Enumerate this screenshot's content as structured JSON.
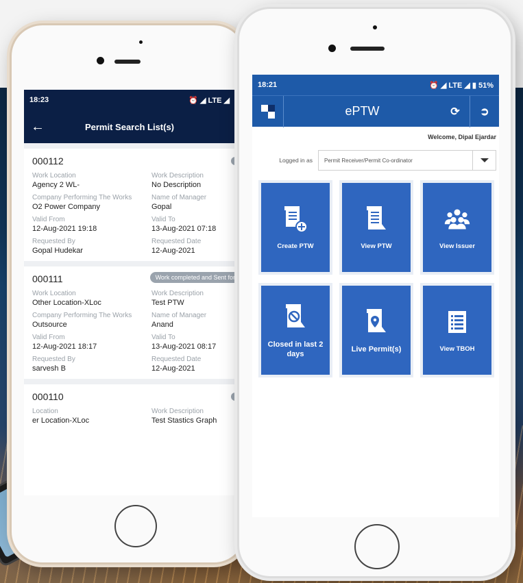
{
  "list_screen": {
    "status_time": "18:23",
    "status_icons": "⏰ ◢ LTE ◢",
    "title": "Permit Search List(s)",
    "permits": [
      {
        "id": "000112",
        "badge": "",
        "fields": [
          {
            "label": "Work Location",
            "value": "Agency 2 WL-"
          },
          {
            "label": "Work Description",
            "value": "No Description"
          },
          {
            "label": "Company Performing The Works",
            "value": "O2 Power Company"
          },
          {
            "label": "Name of Manager",
            "value": "Gopal"
          },
          {
            "label": "Valid From",
            "value": "12-Aug-2021 19:18"
          },
          {
            "label": "Valid To",
            "value": "13-Aug-2021 07:18"
          },
          {
            "label": "Requested By",
            "value": "Gopal Hudekar"
          },
          {
            "label": "Requested Date",
            "value": "12-Aug-2021"
          }
        ]
      },
      {
        "id": "000111",
        "badge": "Work completed and Sent for",
        "fields": [
          {
            "label": "Work Location",
            "value": "Other Location-XLoc"
          },
          {
            "label": "Work Description",
            "value": "Test PTW"
          },
          {
            "label": "Company Performing The Works",
            "value": "Outsource"
          },
          {
            "label": "Name of Manager",
            "value": "Anand"
          },
          {
            "label": "Valid From",
            "value": "12-Aug-2021 18:17"
          },
          {
            "label": "Valid To",
            "value": "13-Aug-2021 08:17"
          },
          {
            "label": "Requested By",
            "value": "sarvesh B"
          },
          {
            "label": "Requested Date",
            "value": "12-Aug-2021"
          }
        ]
      },
      {
        "id": "000110",
        "badge": "",
        "fields": [
          {
            "label": "Location",
            "value": "er Location-XLoc"
          },
          {
            "label": "Work Description",
            "value": "Test Stastics Graph"
          }
        ]
      }
    ]
  },
  "home_screen": {
    "status_time": "18:21",
    "status_icons": "⏰ ◢ LTE ◢ ▮ 51%",
    "app_title": "ePTW",
    "welcome": "Welcome, Dipal Ejardar",
    "logged_in_label": "Logged in as",
    "role_value": "Permit Receiver/Permit Co-ordinator",
    "tiles": [
      {
        "label": "Create PTW",
        "icon": "create-ptw-icon"
      },
      {
        "label": "View PTW",
        "icon": "view-ptw-icon"
      },
      {
        "label": "View Issuer",
        "icon": "people-icon"
      },
      {
        "label": "Closed in last 2 days",
        "icon": "closed-permit-icon"
      },
      {
        "label": "Live Permit(s)",
        "icon": "live-permit-icon"
      },
      {
        "label": "View TBOH",
        "icon": "list-icon"
      }
    ]
  },
  "colors": {
    "app_blue": "#2f66bf",
    "navy": "#0b1f45",
    "badge_grey": "#9aa3ad"
  }
}
